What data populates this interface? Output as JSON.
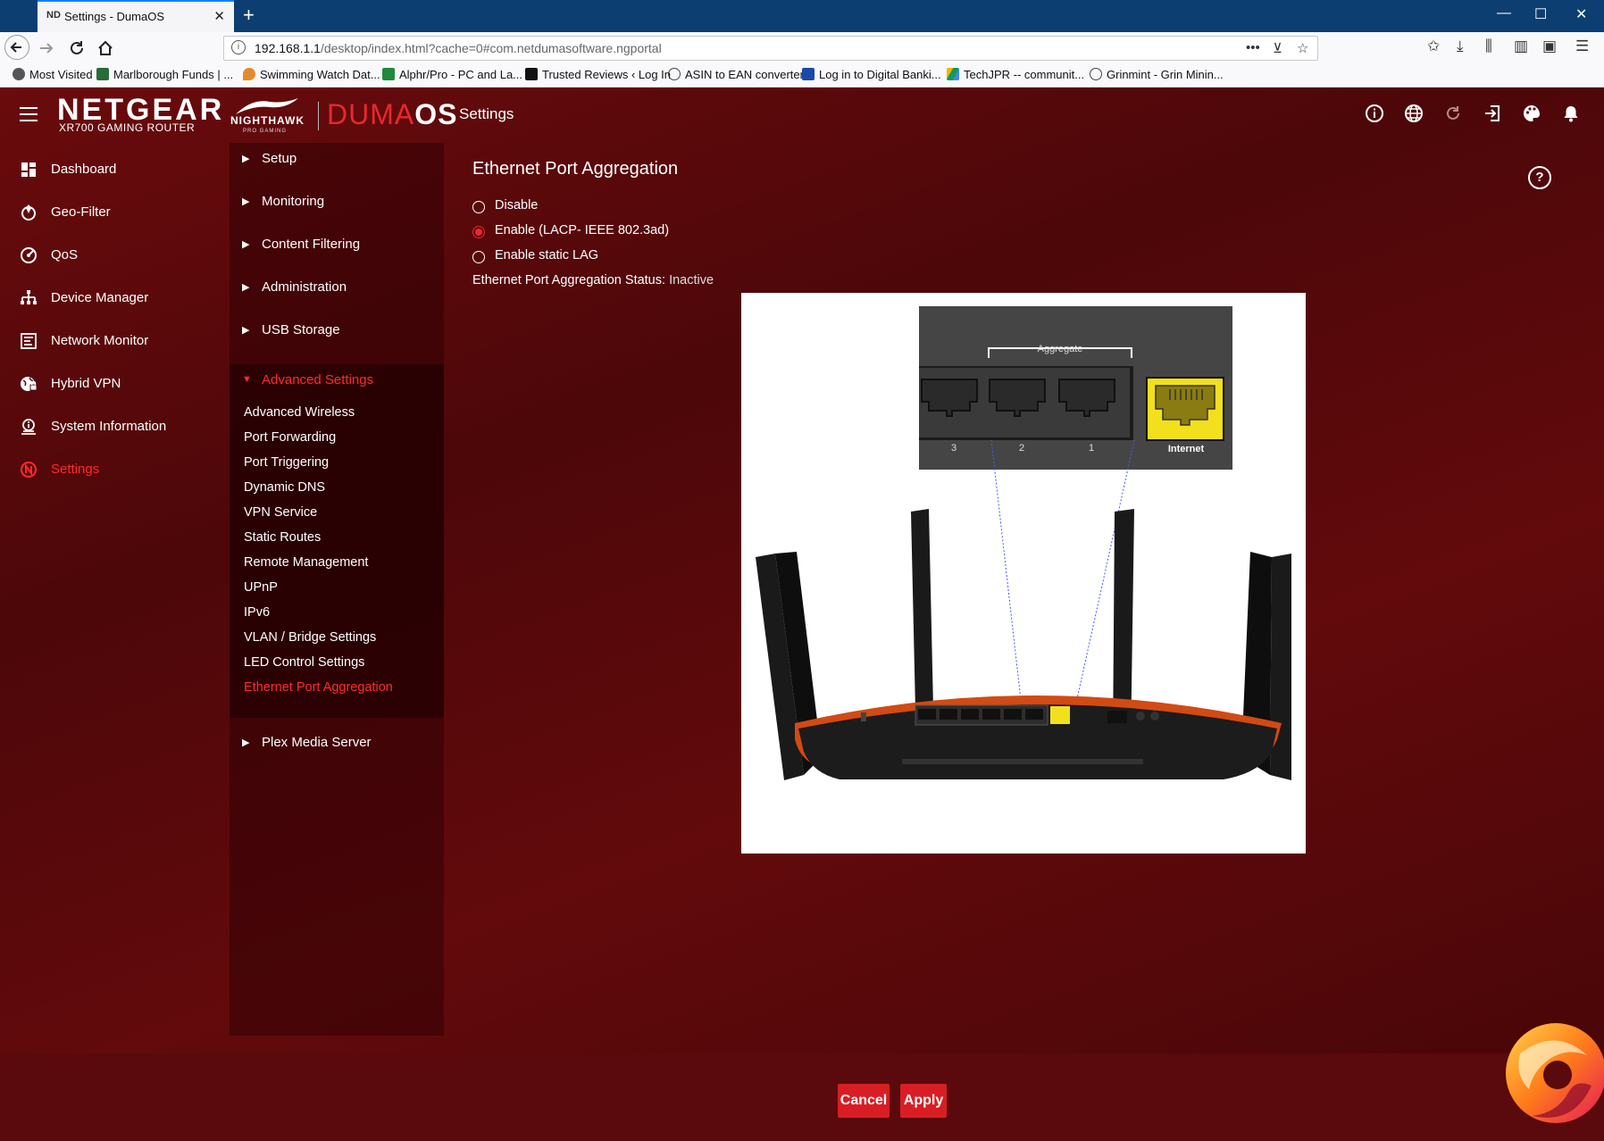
{
  "browser": {
    "tab_title": "Settings - DumaOS",
    "tab_favicon": "ND",
    "url_host": "192.168.1.1",
    "url_path": "/desktop/index.html?cache=0#com.netdumasoftware.ngportal",
    "bookmarks": [
      {
        "label": "Most Visited",
        "icon": "gear-icon",
        "color": "#555555"
      },
      {
        "label": "Marlborough Funds | ...",
        "icon": "m-logo-icon",
        "color": "#2a6b3a"
      },
      {
        "label": "Swimming Watch Dat...",
        "icon": "pin-icon",
        "color": "#e58a2a"
      },
      {
        "label": "Alphr/Pro - PC and La...",
        "icon": "sheet-icon",
        "color": "#1f8a3a"
      },
      {
        "label": "Trusted Reviews ‹ Log In",
        "icon": "t-logo-icon",
        "color": "#111111"
      },
      {
        "label": "ASIN to EAN converter",
        "icon": "globe-icon",
        "color": "#444444"
      },
      {
        "label": "Log in to Digital Banki...",
        "icon": "bank-icon",
        "color": "#1a4aa8"
      },
      {
        "label": "TechJPR -- communit...",
        "icon": "drive-icon",
        "color": "#2a9d4a"
      },
      {
        "label": "Grinmint - Grin Minin...",
        "icon": "globe-icon",
        "color": "#444444"
      }
    ]
  },
  "header": {
    "brand": "NETGEAR",
    "brand_sub": "XR700 GAMING ROUTER",
    "nighthawk": "NIGHTHAWK",
    "nighthawk_sub": "PRO GAMING",
    "duma": "DUMA",
    "duma_os": "OS",
    "page": "Settings"
  },
  "leftnav": [
    {
      "label": "Dashboard",
      "icon": "dashboard-icon"
    },
    {
      "label": "Geo-Filter",
      "icon": "geo-filter-icon"
    },
    {
      "label": "QoS",
      "icon": "qos-icon"
    },
    {
      "label": "Device Manager",
      "icon": "device-manager-icon"
    },
    {
      "label": "Network Monitor",
      "icon": "network-monitor-icon"
    },
    {
      "label": "Hybrid VPN",
      "icon": "hybrid-vpn-icon"
    },
    {
      "label": "System Information",
      "icon": "system-information-icon"
    },
    {
      "label": "Settings",
      "icon": "settings-icon",
      "active": true
    }
  ],
  "subnav": {
    "groups": [
      "Setup",
      "Monitoring",
      "Content Filtering",
      "Administration",
      "USB Storage"
    ],
    "advanced_label": "Advanced Settings",
    "advanced_items": [
      "Advanced Wireless",
      "Port Forwarding",
      "Port Triggering",
      "Dynamic DNS",
      "VPN Service",
      "Static Routes",
      "Remote Management",
      "UPnP",
      "IPv6",
      "VLAN / Bridge Settings",
      "LED Control Settings",
      "Ethernet Port Aggregation"
    ],
    "after_group": "Plex Media Server"
  },
  "main": {
    "title": "Ethernet Port Aggregation",
    "options": [
      "Disable",
      "Enable (LACP- IEEE 802.3ad)",
      "Enable static LAG"
    ],
    "selected_option": 1,
    "status_label": "Ethernet Port Aggregation Status:",
    "status_value": "Inactive",
    "diagram": {
      "aggregate_label": "Aggregate",
      "port_numbers": [
        "3",
        "2",
        "1"
      ],
      "internet_label": "Internet"
    },
    "cancel": "Cancel",
    "apply": "Apply"
  },
  "colors": {
    "accent": "#e8282d",
    "button": "#d81e24",
    "background": "#5a0a0c"
  }
}
